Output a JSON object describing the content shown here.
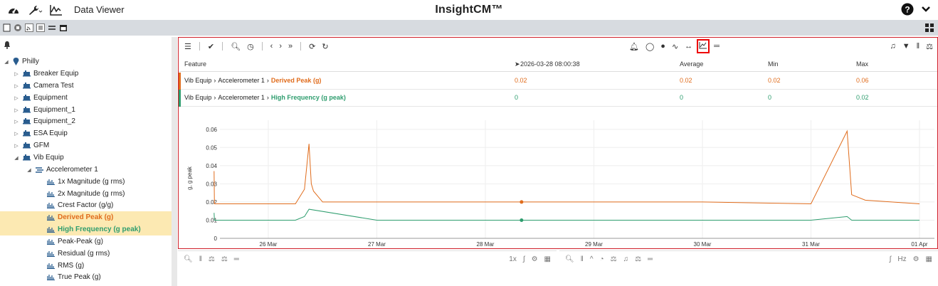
{
  "app": {
    "name": "Data Viewer",
    "title": "InsightCM™"
  },
  "tree": {
    "root": "Philly",
    "items": [
      {
        "label": "Breaker Equip"
      },
      {
        "label": "Camera Test"
      },
      {
        "label": "Equipment"
      },
      {
        "label": "Equipment_1"
      },
      {
        "label": "Equipment_2"
      },
      {
        "label": "ESA Equip"
      },
      {
        "label": "GFM"
      },
      {
        "label": "Vib Equip"
      },
      {
        "label": "Accelerometer 1"
      },
      {
        "label": "1x Magnitude (g rms)"
      },
      {
        "label": "2x Magnitude (g rms)"
      },
      {
        "label": "Crest Factor (g/g)"
      },
      {
        "label": "Derived Peak (g)"
      },
      {
        "label": "High Frequency (g peak)"
      },
      {
        "label": "Peak-Peak (g)"
      },
      {
        "label": "Residual (g rms)"
      },
      {
        "label": "RMS (g)"
      },
      {
        "label": "True Peak (g)"
      }
    ]
  },
  "table": {
    "headers": {
      "feature": "Feature",
      "timestamp": "2026-03-28 08:00:38",
      "average": "Average",
      "min": "Min",
      "max": "Max"
    },
    "rows": [
      {
        "path1": "Vib Equip",
        "path2": "Accelerometer 1",
        "name": "Derived Peak (g)",
        "value": "0.02",
        "average": "0.02",
        "min": "0.02",
        "max": "0.06",
        "color": "#e06c1c"
      },
      {
        "path1": "Vib Equip",
        "path2": "Accelerometer 1",
        "name": "High Frequency (g peak)",
        "value": "0",
        "average": "0",
        "min": "0",
        "max": "0.02",
        "color": "#2e9d6e"
      }
    ],
    "separator": "›"
  },
  "bottom": {
    "zoom": "1x",
    "unit": "Hz"
  },
  "chart_data": {
    "type": "line",
    "ylabel": "g, g peak",
    "ylim": [
      0,
      0.065
    ],
    "yticks": [
      "0.06",
      "0.05",
      "0.04",
      "0.03",
      "0.02",
      "0.01",
      "0"
    ],
    "xticks": [
      "26 Mar",
      "27 Mar",
      "28 Mar",
      "29 Mar",
      "30 Mar",
      "31 Mar",
      "01 Apr"
    ],
    "grid": true,
    "series": [
      {
        "name": "Derived Peak (g)",
        "color": "#e06c1c",
        "x": [
          "2026-03-25 12:00",
          "2026-03-25 12:05",
          "2026-03-25 13:00",
          "2026-03-26 06:00",
          "2026-03-26 08:00",
          "2026-03-26 09:00",
          "2026-03-26 09:30",
          "2026-03-26 10:00",
          "2026-03-26 12:00",
          "2026-03-27 00:00",
          "2026-03-28 08:00",
          "2026-03-29 00:00",
          "2026-03-30 00:00",
          "2026-03-31 00:00",
          "2026-03-31 08:00",
          "2026-03-31 09:00",
          "2026-03-31 12:00",
          "2026-04-01 00:00"
        ],
        "y": [
          0.037,
          0.019,
          0.019,
          0.019,
          0.027,
          0.052,
          0.03,
          0.026,
          0.02,
          0.02,
          0.02,
          0.02,
          0.02,
          0.019,
          0.059,
          0.024,
          0.021,
          0.019
        ]
      },
      {
        "name": "High Frequency (g peak)",
        "color": "#2e9d6e",
        "x": [
          "2026-03-25 12:00",
          "2026-03-25 12:05",
          "2026-03-26 06:00",
          "2026-03-26 08:00",
          "2026-03-26 09:00",
          "2026-03-27 00:00",
          "2026-03-28 08:00",
          "2026-03-29 00:00",
          "2026-03-30 00:00",
          "2026-03-31 00:00",
          "2026-03-31 08:00",
          "2026-03-31 09:00",
          "2026-04-01 00:00"
        ],
        "y": [
          0.014,
          0.01,
          0.01,
          0.012,
          0.016,
          0.01,
          0.01,
          0.01,
          0.01,
          0.01,
          0.012,
          0.01,
          0.01
        ]
      }
    ],
    "markers_at": "2026-03-28 08:00"
  }
}
